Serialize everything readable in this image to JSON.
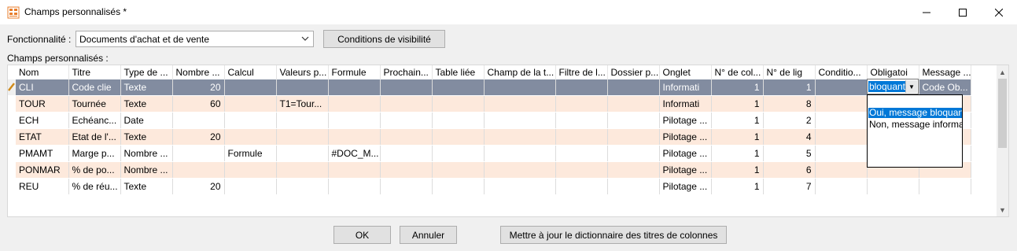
{
  "window": {
    "title": "Champs personnalisés *",
    "icon": "custom-fields-app-icon",
    "controls": {
      "minimize": "minimize-icon",
      "maximize": "maximize-icon",
      "close": "close-icon"
    }
  },
  "filters": {
    "fonctionnalite_label": "Fonctionnalité :",
    "fonctionnalite_value": "Documents d'achat et de vente",
    "conditions_button": "Conditions de visibilité"
  },
  "grid_label": "Champs personnalisés :",
  "columns": [
    "Nom",
    "Titre",
    "Type de ...",
    "Nombre ...",
    "Calcul",
    "Valeurs p...",
    "Formule",
    "Prochain...",
    "Table liée",
    "Champ de la t...",
    "Filtre de l...",
    "Dossier p...",
    "Onglet",
    "N° de col...",
    "N° de lig",
    "Conditio...",
    "Obligatoi",
    "Message ..."
  ],
  "rows": [
    [
      "CLI",
      "Code clie",
      "Texte",
      "20",
      "",
      "",
      "",
      "",
      "",
      "",
      "",
      "",
      "Informati",
      "1",
      "1",
      "",
      "bloquant",
      "Code Ob..."
    ],
    [
      "TOUR",
      "Tournée",
      "Texte",
      "60",
      "",
      "T1=Tour...",
      "",
      "",
      "",
      "",
      "",
      "",
      "Informati",
      "1",
      "8",
      "",
      "",
      ""
    ],
    [
      "ECH",
      "Echéanc...",
      "Date",
      "",
      "",
      "",
      "",
      "",
      "",
      "",
      "",
      "",
      "Pilotage ...",
      "1",
      "2",
      "",
      "",
      ""
    ],
    [
      "ETAT",
      "Etat de l'...",
      "Texte",
      "20",
      "",
      "",
      "",
      "",
      "",
      "",
      "",
      "",
      "Pilotage ...",
      "1",
      "4",
      "",
      "",
      ""
    ],
    [
      "PMAMT",
      "Marge p...",
      "Nombre ...",
      "",
      "Formule",
      "",
      "#DOC_M...",
      "",
      "",
      "",
      "",
      "",
      "Pilotage ...",
      "1",
      "5",
      "",
      "",
      ""
    ],
    [
      "PONMAR",
      "% de po...",
      "Nombre ...",
      "",
      "",
      "",
      "",
      "",
      "",
      "",
      "",
      "",
      "Pilotage ...",
      "1",
      "6",
      "",
      "",
      ""
    ],
    [
      "REU",
      "% de réu...",
      "Texte",
      "20",
      "",
      "",
      "",
      "",
      "",
      "",
      "",
      "",
      "Pilotage ...",
      "1",
      "7",
      "",
      "",
      ""
    ]
  ],
  "editor": {
    "value": "bloquant",
    "options": [
      "Oui, message bloquant",
      "Non, message informatif"
    ]
  },
  "buttons": {
    "ok": "OK",
    "annuler": "Annuler",
    "maj": "Mettre à jour le dictionnaire des titres de colonnes"
  },
  "colors": {
    "selected_row": "#828ca0",
    "alt_row": "#fde9dc",
    "highlight": "#0078d7"
  }
}
